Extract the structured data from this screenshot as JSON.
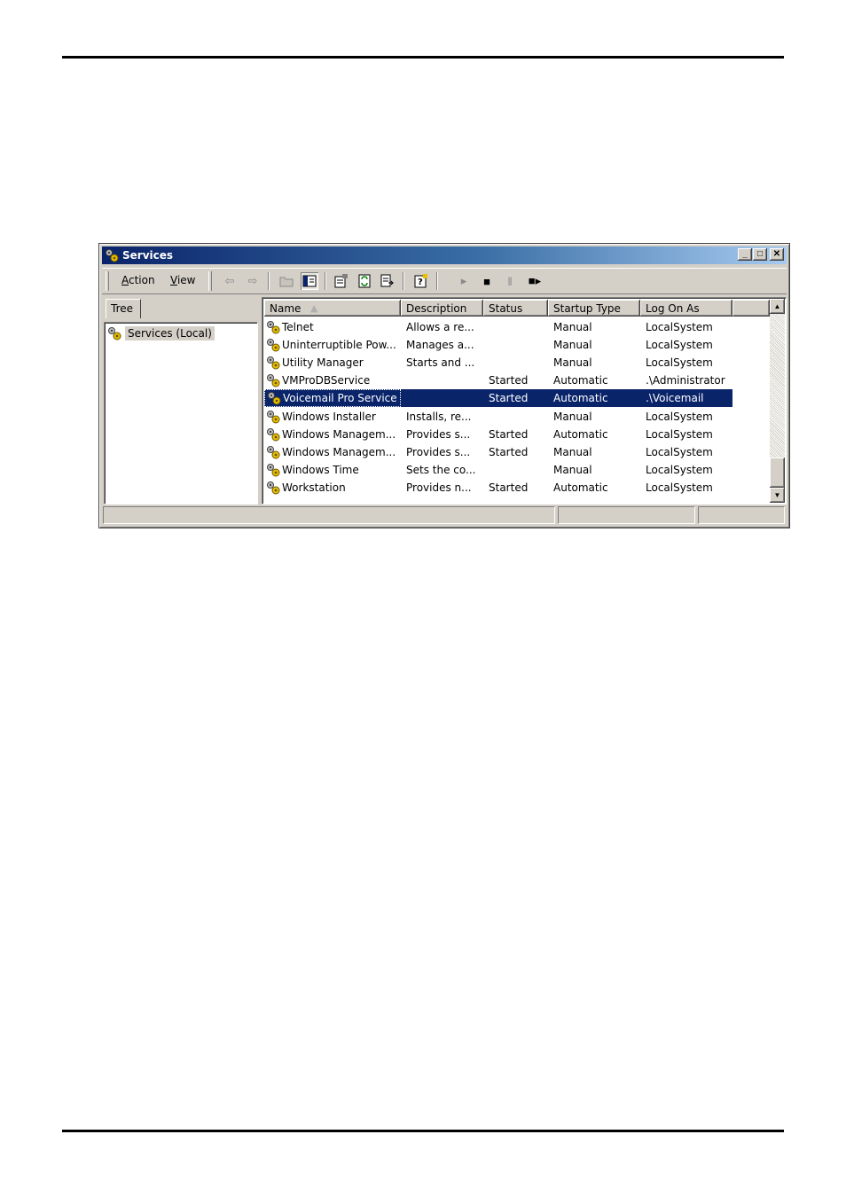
{
  "window": {
    "title": "Services",
    "app_icon": "services-gears-icon",
    "controls": {
      "minimize": "_",
      "maximize": "□",
      "close": "✕"
    }
  },
  "menu": {
    "action": {
      "accel": "A",
      "rest": "ction"
    },
    "view": {
      "accel": "V",
      "rest": "iew"
    }
  },
  "toolbar": {
    "icons": [
      "back-arrow-icon",
      "forward-arrow-icon",
      "up-folder-icon",
      "show-hide-tree-icon",
      "properties-icon",
      "refresh-icon",
      "export-list-icon",
      "help-icon",
      "start-service-icon",
      "stop-service-icon",
      "pause-service-icon",
      "restart-service-icon"
    ]
  },
  "tree": {
    "tab_label": "Tree",
    "root": "Services (Local)"
  },
  "list": {
    "columns": [
      "Name",
      "Description",
      "Status",
      "Startup Type",
      "Log On As"
    ],
    "sort_indicator": "▲",
    "rows": [
      {
        "name": "Telnet",
        "description": "Allows a re...",
        "status": "",
        "startup": "Manual",
        "logon": "LocalSystem"
      },
      {
        "name": "Uninterruptible Pow...",
        "description": "Manages a...",
        "status": "",
        "startup": "Manual",
        "logon": "LocalSystem"
      },
      {
        "name": "Utility Manager",
        "description": "Starts and ...",
        "status": "",
        "startup": "Manual",
        "logon": "LocalSystem"
      },
      {
        "name": "VMProDBService",
        "description": "",
        "status": "Started",
        "startup": "Automatic",
        "logon": ".\\Administrator"
      },
      {
        "name": "Voicemail Pro Service",
        "description": "",
        "status": "Started",
        "startup": "Automatic",
        "logon": ".\\Voicemail",
        "selected": true
      },
      {
        "name": "Windows Installer",
        "description": "Installs, re...",
        "status": "",
        "startup": "Manual",
        "logon": "LocalSystem"
      },
      {
        "name": "Windows Managem...",
        "description": "Provides s...",
        "status": "Started",
        "startup": "Automatic",
        "logon": "LocalSystem"
      },
      {
        "name": "Windows Managem...",
        "description": "Provides s...",
        "status": "Started",
        "startup": "Manual",
        "logon": "LocalSystem"
      },
      {
        "name": "Windows Time",
        "description": "Sets the co...",
        "status": "",
        "startup": "Manual",
        "logon": "LocalSystem"
      },
      {
        "name": "Workstation",
        "description": "Provides n...",
        "status": "Started",
        "startup": "Automatic",
        "logon": "LocalSystem"
      }
    ]
  },
  "scrollbar": {
    "up": "▲",
    "down": "▼"
  },
  "colors": {
    "titlebar_start": "#0a246a",
    "titlebar_end": "#a6caf0",
    "selection": "#0a246a",
    "chrome": "#d4d0c8"
  }
}
